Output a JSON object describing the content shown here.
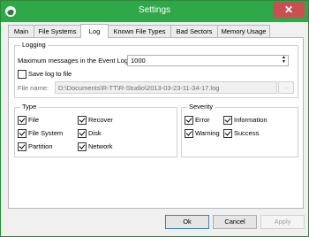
{
  "window": {
    "title": "Settings",
    "accent": "#2fa84a"
  },
  "tabs": [
    {
      "label": "Main"
    },
    {
      "label": "File Systems"
    },
    {
      "label": "Log"
    },
    {
      "label": "Known File Types"
    },
    {
      "label": "Bad Sectors"
    },
    {
      "label": "Memory Usage"
    }
  ],
  "logging": {
    "legend": "Logging",
    "max_messages_label": "Maximum messages in the Event Log:",
    "max_messages_value": "1000",
    "save_log_label": "Save log to file",
    "save_log_checked": false,
    "file_name_label": "File name:",
    "file_name_value": "D:\\Documents\\R-TT\\R-Studio\\2013-03-23-11-34-17.log",
    "browse_label": "..."
  },
  "type": {
    "legend": "Type",
    "items": [
      {
        "label": "File",
        "checked": true
      },
      {
        "label": "File System",
        "checked": true
      },
      {
        "label": "Partition",
        "checked": true
      },
      {
        "label": "Recover",
        "checked": true
      },
      {
        "label": "Disk",
        "checked": true
      },
      {
        "label": "Network",
        "checked": true
      }
    ]
  },
  "severity": {
    "legend": "Severity",
    "items": [
      {
        "label": "Error",
        "checked": true
      },
      {
        "label": "Warning",
        "checked": true
      },
      {
        "label": "Information",
        "checked": true
      },
      {
        "label": "Success",
        "checked": true
      }
    ]
  },
  "buttons": {
    "ok": "Ok",
    "cancel": "Cancel",
    "apply": "Apply"
  }
}
